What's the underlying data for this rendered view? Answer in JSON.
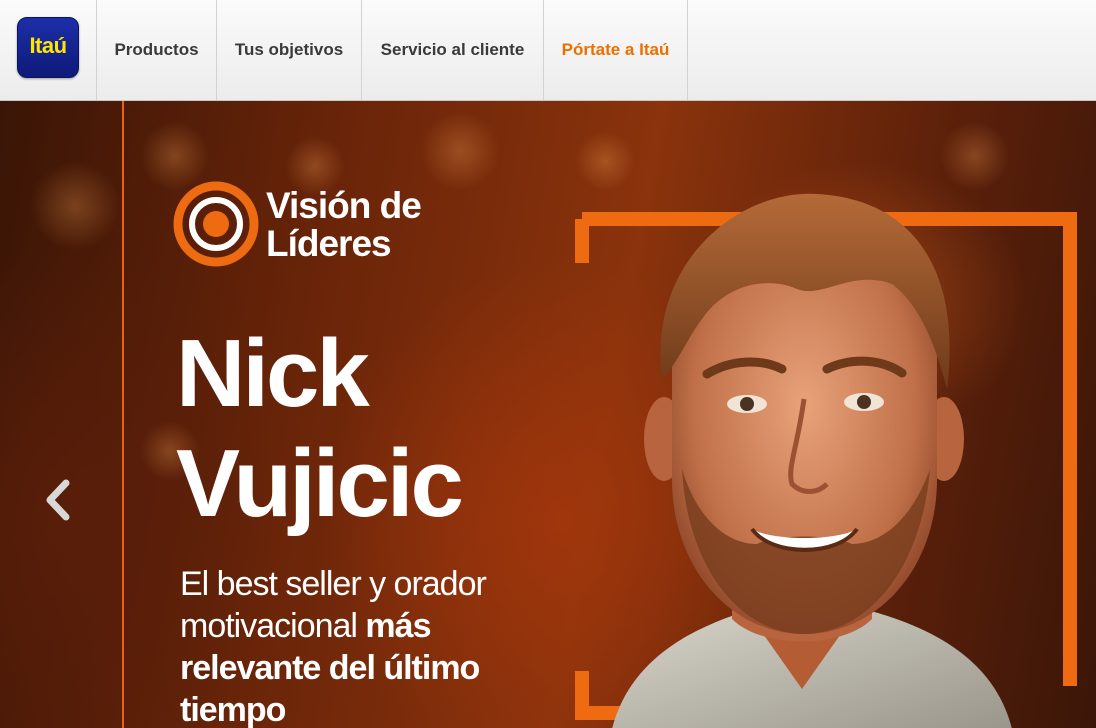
{
  "header": {
    "logo_text": "Itaú",
    "nav": [
      {
        "label": "Productos"
      },
      {
        "label": "Tus objetivos"
      },
      {
        "label": "Servicio al cliente"
      },
      {
        "label": "Pórtate a Itaú",
        "accent": "#ec7000"
      }
    ]
  },
  "hero": {
    "brand_line1": "Visión de",
    "brand_line2": "Líderes",
    "name_line1": "Nick",
    "name_line2": "Vujicic",
    "desc_line1": "El best seller y orador",
    "desc_line2_regular": "motivacional ",
    "desc_line2_bold": "más",
    "desc_line3": "relevante del último",
    "desc_line4": "tiempo",
    "prev_icon": "chevron-left-icon",
    "accent_color": "#ee6b12"
  }
}
